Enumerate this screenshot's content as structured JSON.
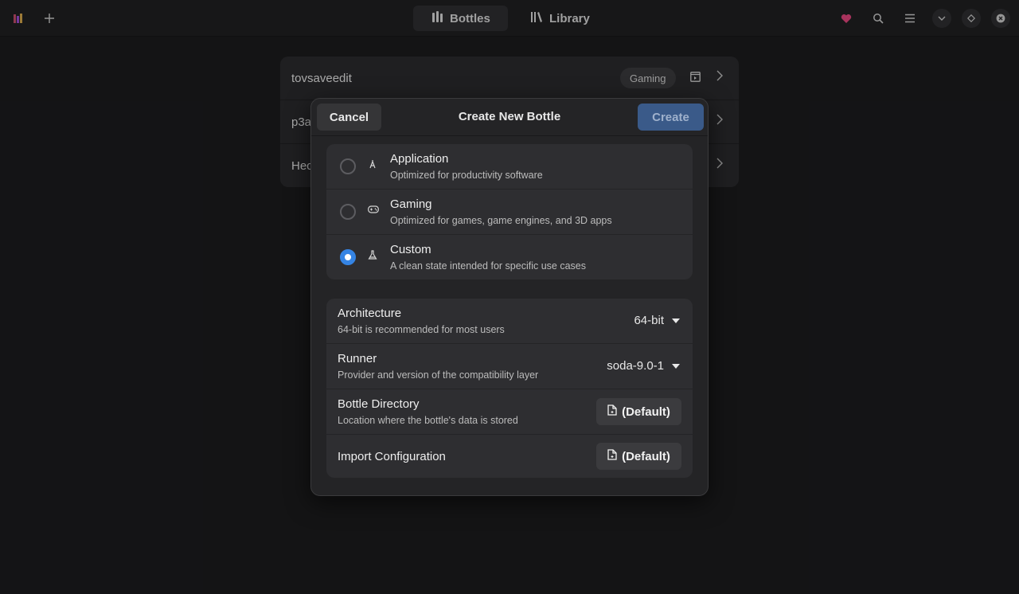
{
  "header": {
    "tabs": [
      {
        "label": "Bottles",
        "icon": "bottles-icon"
      },
      {
        "label": "Library",
        "icon": "library-icon"
      }
    ]
  },
  "bottles": [
    {
      "name": "tovsaveedit",
      "tag": "Gaming"
    },
    {
      "name": "p3a"
    },
    {
      "name": "Hec"
    }
  ],
  "dialog": {
    "title": "Create New Bottle",
    "cancel_label": "Cancel",
    "create_label": "Create",
    "environments": [
      {
        "title": "Application",
        "subtitle": "Optimized for productivity software",
        "icon": "compass-icon",
        "selected": false
      },
      {
        "title": "Gaming",
        "subtitle": "Optimized for games, game engines, and 3D apps",
        "icon": "gamepad-icon",
        "selected": false
      },
      {
        "title": "Custom",
        "subtitle": "A clean state intended for specific use cases",
        "icon": "flask-icon",
        "selected": true
      }
    ],
    "settings": {
      "architecture": {
        "title": "Architecture",
        "subtitle": "64-bit is recommended for most users",
        "value": "64-bit"
      },
      "runner": {
        "title": "Runner",
        "subtitle": "Provider and version of the compatibility layer",
        "value": "soda-9.0-1"
      },
      "directory": {
        "title": "Bottle Directory",
        "subtitle": "Location where the bottle's data is stored",
        "value": "(Default)"
      },
      "import": {
        "title": "Import Configuration",
        "value": "(Default)"
      }
    }
  },
  "colors": {
    "accent": "#3584e4",
    "heart": "#e0457b",
    "create_button": "#3a5a89"
  }
}
